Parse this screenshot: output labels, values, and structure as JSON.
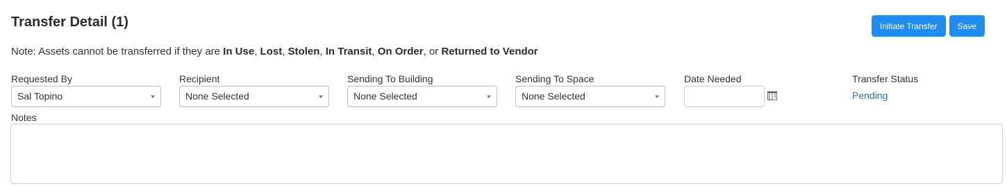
{
  "header": {
    "title": "Transfer Detail (1)",
    "initiate_label": "Initiate Transfer",
    "save_label": "Save"
  },
  "note": {
    "prefix": "Note: Assets cannot be transferred if they are ",
    "in_use": "In Use",
    "sep1": ", ",
    "lost": "Lost",
    "sep2": ", ",
    "stolen": "Stolen",
    "sep3": ", ",
    "in_transit": "In Transit",
    "sep4": ", ",
    "on_order": "On Order",
    "sep5": ", or ",
    "returned": "Returned to Vendor"
  },
  "fields": {
    "requested_by": {
      "label": "Requested By",
      "value": "Sal Topino"
    },
    "recipient": {
      "label": "Recipient",
      "value": "None Selected"
    },
    "building": {
      "label": "Sending To Building",
      "value": "None Selected"
    },
    "space": {
      "label": "Sending To Space",
      "value": "None Selected"
    },
    "date_needed": {
      "label": "Date Needed",
      "value": ""
    },
    "status": {
      "label": "Transfer Status",
      "value": "Pending"
    }
  },
  "notes": {
    "label": "Notes",
    "value": ""
  },
  "colors": {
    "primary_button": "#1e8cf0",
    "status_link": "#2a6fa8",
    "border": "#b9b9b9"
  },
  "icons": {
    "select_caret": "chevron-down-icon",
    "date_picker": "calendar-icon"
  }
}
